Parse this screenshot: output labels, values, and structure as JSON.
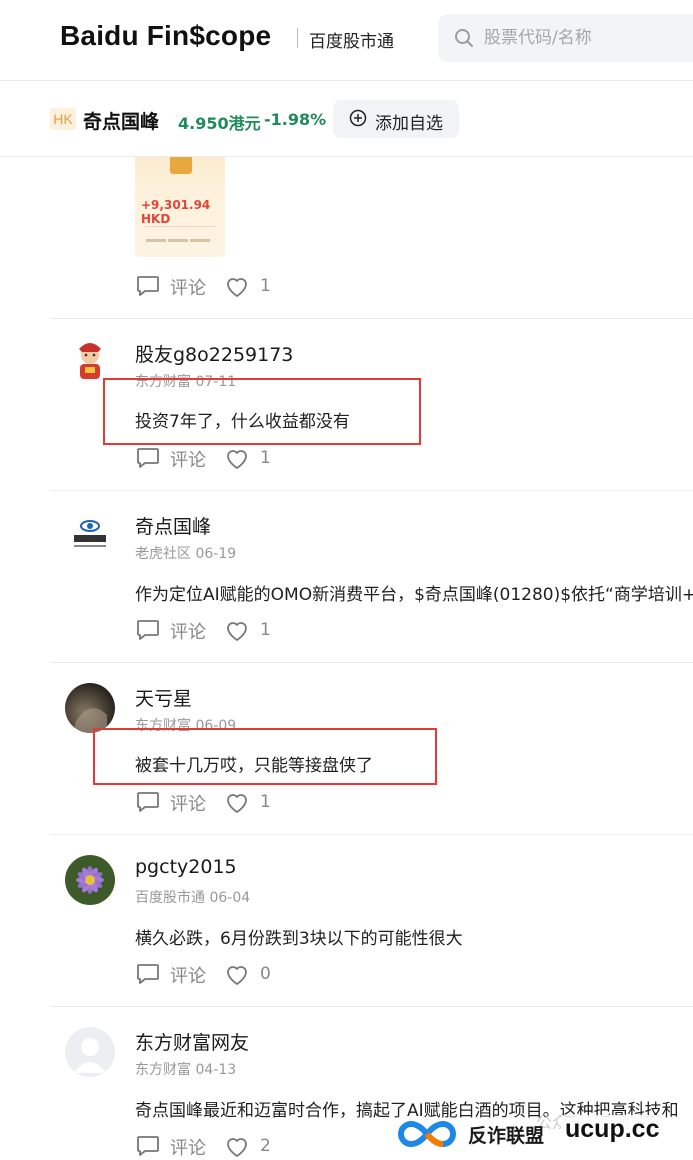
{
  "header": {
    "logo": "Baidu Fin$cope",
    "subtitle": "百度股市通",
    "search_placeholder": "股票代码/名称"
  },
  "stock": {
    "market": "HK",
    "name": "奇点国峰",
    "price": "4.950港元",
    "change": "-1.98%",
    "watch_label": "添加自选"
  },
  "top_card": {
    "image_amount": "+9,301.94 HKD",
    "comment_label": "评论",
    "like_count": "1"
  },
  "posts": [
    {
      "user": "股友g8o2259173",
      "source": "东方财富 07-11",
      "text": "投资7年了，什么收益都没有",
      "comment_label": "评论",
      "like_count": "1"
    },
    {
      "user": "奇点国峰",
      "source": "老虎社区 06-19",
      "text": "作为定位AI赋能的OMO新消费平台，$奇点国峰(01280)$依托“商学培训+",
      "comment_label": "评论",
      "like_count": "1"
    },
    {
      "user": "天亏星",
      "source": "东方财富 06-09",
      "text": "被套十几万哎，只能等接盘侠了",
      "comment_label": "评论",
      "like_count": "1"
    },
    {
      "user": "pgcty2015",
      "source": "百度股市通 06-04",
      "text": "横久必跌，6月份跌到3块以下的可能性很大",
      "comment_label": "评论",
      "like_count": "0"
    },
    {
      "user": "东方财富网友",
      "source": "东方财富 04-13",
      "text": "奇点国峰最近和迈富时合作，搞起了AI赋能白酒的项目。这种把高科技和",
      "comment_label": "评论",
      "like_count": "2"
    }
  ],
  "watermark": {
    "faint_text": "公众号 · 监管世界",
    "name": "反诈联盟",
    "domain": "ucup.cc"
  },
  "colors": {
    "down": "#1f8a5a",
    "highlight_box": "#e53935"
  }
}
